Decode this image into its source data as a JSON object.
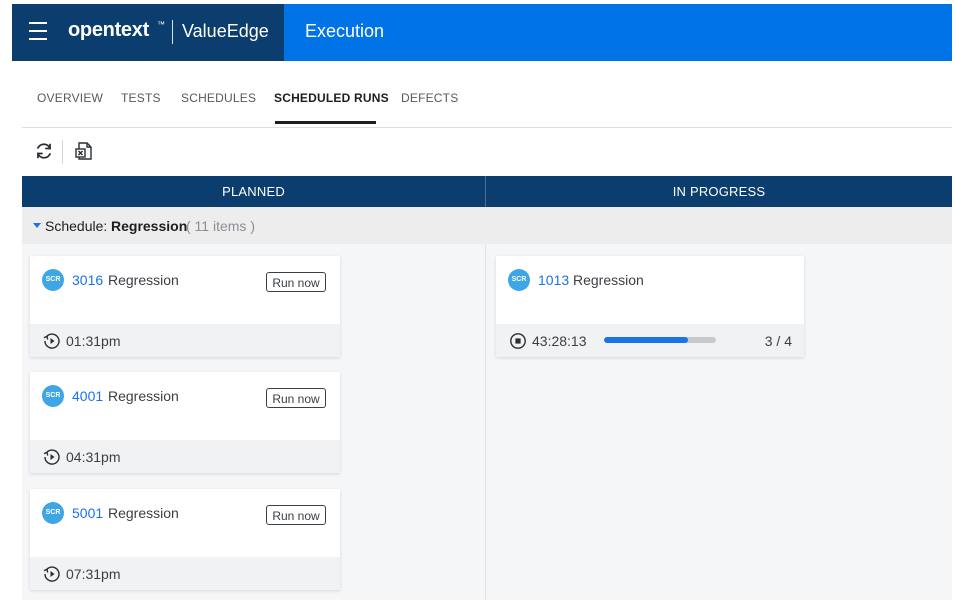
{
  "header": {
    "logo": "opentext",
    "trademark": "™",
    "product": "ValueEdge",
    "module": "Execution"
  },
  "tabs": [
    {
      "label": "OVERVIEW",
      "active": false
    },
    {
      "label": "TESTS",
      "active": false
    },
    {
      "label": "SCHEDULES",
      "active": false
    },
    {
      "label": "SCHEDULED RUNS",
      "active": true
    },
    {
      "label": "DEFECTS",
      "active": false
    }
  ],
  "toolbar": {
    "icons": [
      "refresh-icon",
      "export-excel-icon"
    ]
  },
  "columns": [
    "PLANNED",
    "IN PROGRESS"
  ],
  "group": {
    "label": "Schedule:",
    "name": "Regression",
    "count": "( 11 items )"
  },
  "planned": [
    {
      "badge": "SCR",
      "id": "3016",
      "name": "Regression",
      "action": "Run now",
      "time": "01:31pm"
    },
    {
      "badge": "SCR",
      "id": "4001",
      "name": "Regression",
      "action": "Run now",
      "time": "04:31pm"
    },
    {
      "badge": "SCR",
      "id": "5001",
      "name": "Regression",
      "action": "Run now",
      "time": "07:31pm"
    }
  ],
  "in_progress": [
    {
      "badge": "SCR",
      "id": "1013",
      "name": "Regression",
      "elapsed": "43:28:13",
      "progress": 0.75,
      "count": "3 / 4"
    }
  ],
  "colors": {
    "brand_dark": "#0b3e6f",
    "brand_blue": "#0073e7",
    "link": "#1a73e8",
    "badge": "#3fa6e6"
  }
}
